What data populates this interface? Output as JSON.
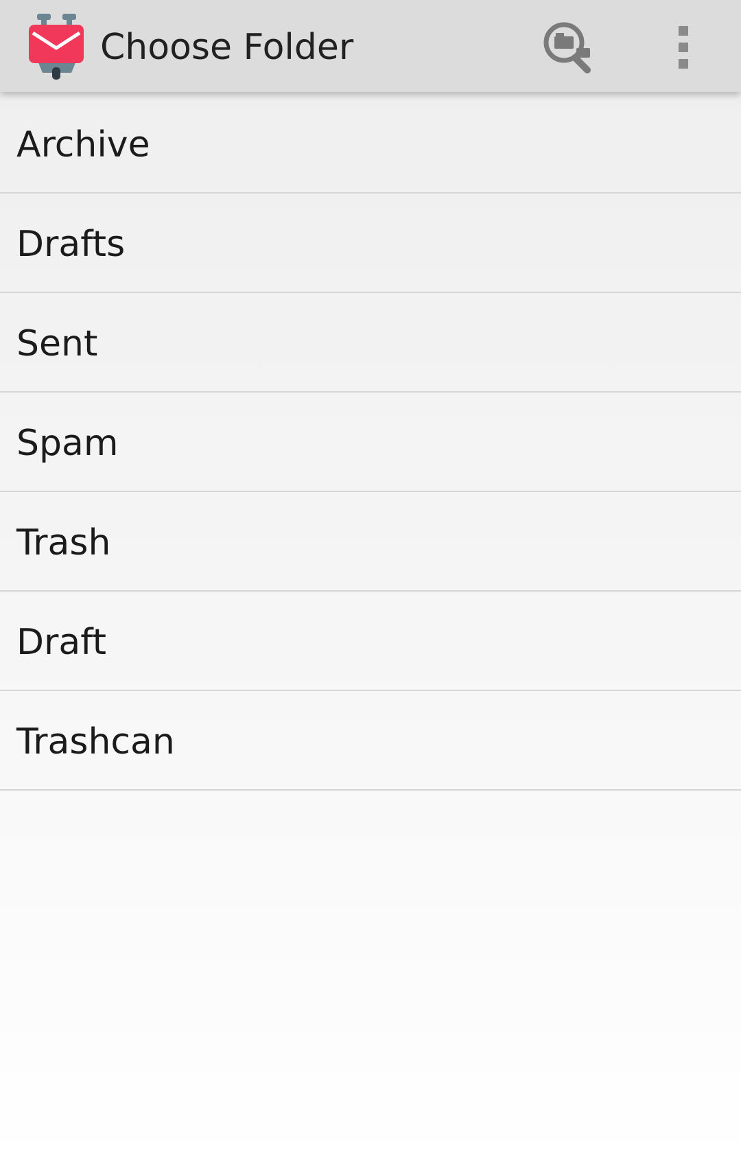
{
  "header": {
    "title": "Choose Folder",
    "logo_icon": "k9-mail-logo-icon",
    "search_icon": "search-folders-icon",
    "menu_icon": "overflow-menu-icon",
    "accent_color": "#f2385a"
  },
  "folders": [
    {
      "name": "Archive"
    },
    {
      "name": "Drafts"
    },
    {
      "name": "Sent"
    },
    {
      "name": "Spam"
    },
    {
      "name": "Trash"
    },
    {
      "name": "Draft"
    },
    {
      "name": "Trashcan"
    }
  ]
}
